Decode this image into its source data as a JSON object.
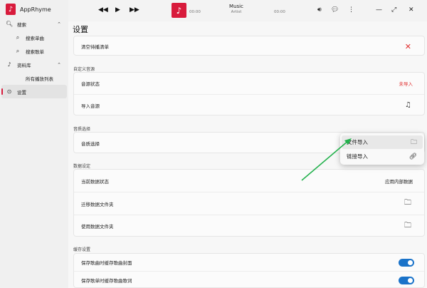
{
  "app": {
    "name": "AppRhyme",
    "logo_icon": "music-note-icon",
    "accent": "#d81b3c"
  },
  "sidebar": {
    "items": [
      {
        "label": "搜索",
        "icon": "search-icon",
        "chevron": "˄"
      },
      {
        "label": "搜索单曲",
        "icon": "search-icon"
      },
      {
        "label": "搜索歌单",
        "icon": "search-icon"
      },
      {
        "label": "资料库",
        "icon": "music-note-icon",
        "chevron": "˄"
      },
      {
        "label": "所有播放列表",
        "icon": ""
      },
      {
        "label": "设置",
        "icon": "settings-icon"
      }
    ]
  },
  "player": {
    "title": "Music",
    "artist": "Artist",
    "time_current": "00:00",
    "time_total": "00:00"
  },
  "main": {
    "title": "设置",
    "clear_queue": "清空待播清单",
    "sections": {
      "custom_source": "自定义音源",
      "quality": "音质选择",
      "data": "数据设定",
      "cache": "缓存设置"
    },
    "source_status_label": "音源状态",
    "source_status_value": "未导入",
    "import_source": "导入音源",
    "quality_label": "音质选择",
    "data_status_label": "当前数据状态",
    "data_status_value": "应用内部数据",
    "migrate_folder": "迁移数据文件夹",
    "use_folder": "使用数据文件夹",
    "cache_cover": "保存歌曲时缓存歌曲封面",
    "cache_lyrics": "保存歌单时缓存歌曲歌词"
  },
  "popup": {
    "file_import": "文件导入",
    "link_import": "链接导入"
  },
  "colors": {
    "toggle_on": "#1a73c9",
    "annotation_arrow": "#22b14c",
    "status_red": "#e03030"
  }
}
